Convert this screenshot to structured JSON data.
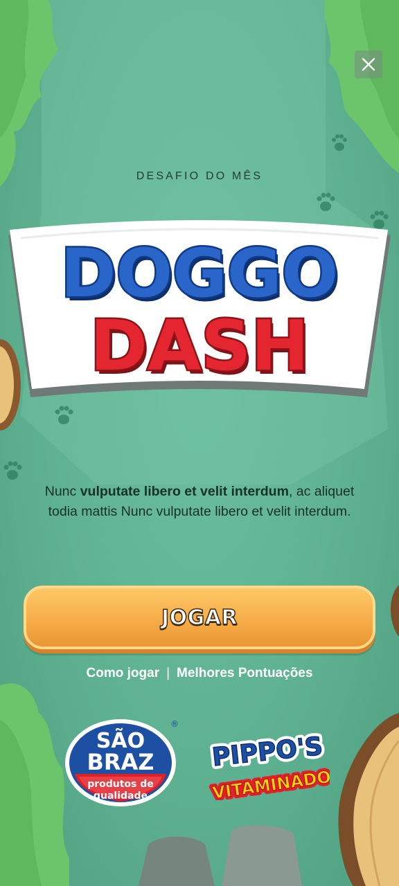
{
  "header": {
    "close_label": "Fechar",
    "subtitle": "DESAFIO DO MÊS"
  },
  "game_logo": {
    "line1": "DOGGO",
    "line2": "DASH"
  },
  "description": {
    "text_before": "Nunc ",
    "text_bold": "vulputate libero et velit interdum",
    "text_after": ", ac aliquet todia mattis Nunc vulputate libero et velit interdum."
  },
  "play_button": {
    "label": "JOGAR"
  },
  "links": {
    "how_to_play": "Como jogar",
    "separator": "|",
    "high_scores": "Melhores Pontuações"
  },
  "sponsors": {
    "sao_braz": {
      "line1": "SÃO",
      "line2": "BRAZ",
      "tag1": "produtos de",
      "tag2": "qualidade",
      "mark": "®"
    },
    "pippos": {
      "line1": "PIPPO'S",
      "line2": "VITAMINADO"
    }
  },
  "colors": {
    "background": "#5eb191",
    "title_blue": "#1a4fa6",
    "title_red": "#e3262f",
    "button_orange": "#f6ad48",
    "brand_red": "#e31f26",
    "brand_blue": "#1d4fa3"
  }
}
